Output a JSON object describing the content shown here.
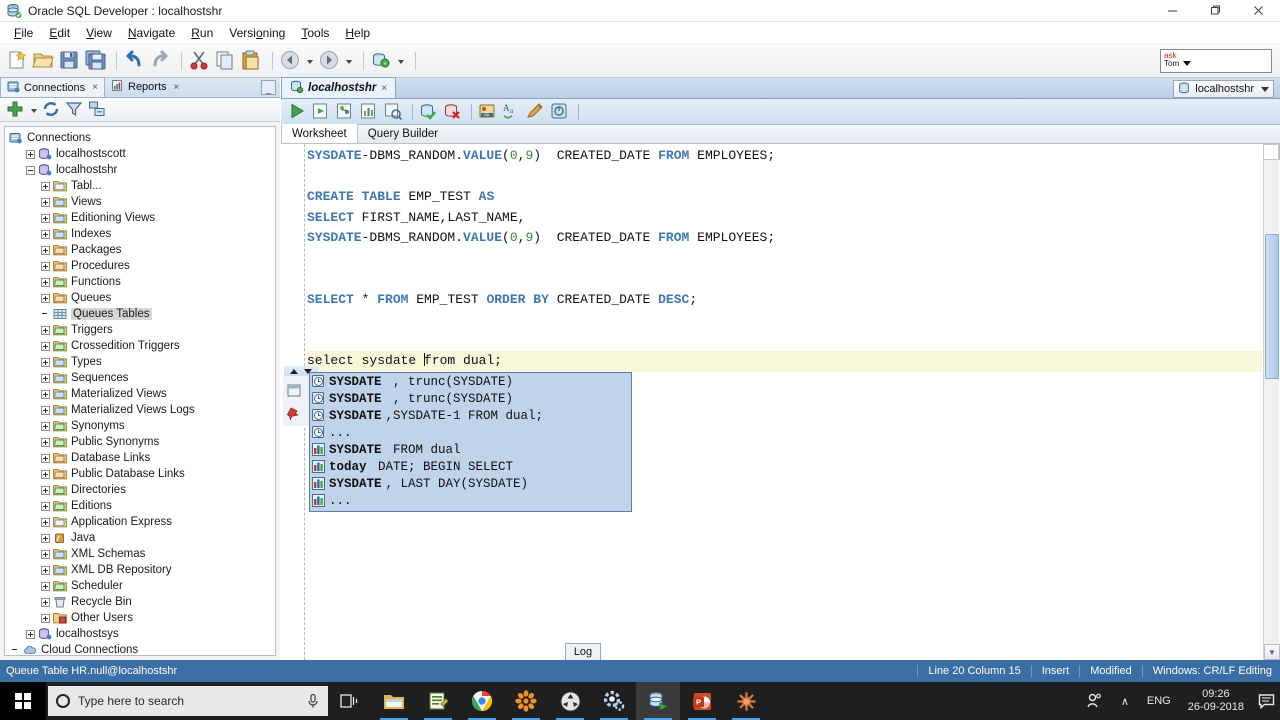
{
  "window": {
    "title": "Oracle SQL Developer : localhostshr",
    "app_icon": "database-app-icon",
    "minimize": "—",
    "maximize": "❐",
    "close": "✕"
  },
  "menubar": {
    "items": [
      {
        "label": "File",
        "mnemonic": "F"
      },
      {
        "label": "Edit",
        "mnemonic": "E"
      },
      {
        "label": "View",
        "mnemonic": "V"
      },
      {
        "label": "Navigate",
        "mnemonic": "N"
      },
      {
        "label": "Run",
        "mnemonic": "R"
      },
      {
        "label": "Versioning",
        "mnemonic": "o"
      },
      {
        "label": "Tools",
        "mnemonic": "T"
      },
      {
        "label": "Help",
        "mnemonic": "H"
      }
    ]
  },
  "main_toolbar": {
    "buttons": [
      "new-file-icon",
      "open-folder-icon",
      "save-icon",
      "save-all-icon",
      "undo-icon",
      "redo-icon",
      "cut-icon",
      "copy-icon",
      "paste-icon",
      "navigate-back-icon",
      "navigate-forward-icon",
      "new-connection-icon"
    ],
    "search_box": {
      "line1": "ask",
      "line2": "Tom"
    }
  },
  "left_dock": {
    "tabs": [
      {
        "label": "Connections",
        "icon": "connections-icon",
        "close": "×",
        "active": true
      },
      {
        "label": "Reports",
        "icon": "reports-icon",
        "close": "×",
        "active": false
      }
    ],
    "minimize_label": "_",
    "toolbar_buttons": [
      "new-connection-plus-icon",
      "dropdown-caret-icon",
      "refresh-icon",
      "filter-icon",
      "collapse-all-icon"
    ],
    "tree": {
      "root": {
        "label": "Connections",
        "icon": "connections-root-icon"
      },
      "nodes": [
        {
          "label": "localhostscott",
          "level": 1,
          "icon": "connection-icon",
          "expander": "plus"
        },
        {
          "label": "localhostshr",
          "level": 1,
          "icon": "connection-icon",
          "expander": "minus"
        },
        {
          "label": "Tabl...",
          "level": 2,
          "icon": "tables-folder-icon",
          "expander": "plus"
        },
        {
          "label": "Views",
          "level": 2,
          "icon": "views-folder-icon",
          "expander": "plus"
        },
        {
          "label": "Editioning Views",
          "level": 2,
          "icon": "editioning-views-icon",
          "expander": "plus"
        },
        {
          "label": "Indexes",
          "level": 2,
          "icon": "indexes-folder-icon",
          "expander": "plus"
        },
        {
          "label": "Packages",
          "level": 2,
          "icon": "packages-folder-icon",
          "expander": "plus"
        },
        {
          "label": "Procedures",
          "level": 2,
          "icon": "procedures-folder-icon",
          "expander": "plus"
        },
        {
          "label": "Functions",
          "level": 2,
          "icon": "functions-folder-icon",
          "expander": "plus"
        },
        {
          "label": "Queues",
          "level": 2,
          "icon": "queues-folder-icon",
          "expander": "plus"
        },
        {
          "label": "Queues Tables",
          "level": 2,
          "icon": "queue-tables-icon",
          "expander": "none",
          "selected": true
        },
        {
          "label": "Triggers",
          "level": 2,
          "icon": "triggers-folder-icon",
          "expander": "plus"
        },
        {
          "label": "Crossedition Triggers",
          "level": 2,
          "icon": "crossedition-triggers-icon",
          "expander": "plus"
        },
        {
          "label": "Types",
          "level": 2,
          "icon": "types-folder-icon",
          "expander": "plus"
        },
        {
          "label": "Sequences",
          "level": 2,
          "icon": "sequences-folder-icon",
          "expander": "plus"
        },
        {
          "label": "Materialized Views",
          "level": 2,
          "icon": "materialized-views-icon",
          "expander": "plus"
        },
        {
          "label": "Materialized Views Logs",
          "level": 2,
          "icon": "materialized-views-logs-icon",
          "expander": "plus"
        },
        {
          "label": "Synonyms",
          "level": 2,
          "icon": "synonyms-folder-icon",
          "expander": "plus"
        },
        {
          "label": "Public Synonyms",
          "level": 2,
          "icon": "public-synonyms-icon",
          "expander": "plus"
        },
        {
          "label": "Database Links",
          "level": 2,
          "icon": "database-links-icon",
          "expander": "plus"
        },
        {
          "label": "Public Database Links",
          "level": 2,
          "icon": "public-database-links-icon",
          "expander": "plus"
        },
        {
          "label": "Directories",
          "level": 2,
          "icon": "directories-folder-icon",
          "expander": "plus"
        },
        {
          "label": "Editions",
          "level": 2,
          "icon": "editions-folder-icon",
          "expander": "plus"
        },
        {
          "label": "Application Express",
          "level": 2,
          "icon": "application-express-icon",
          "expander": "plus"
        },
        {
          "label": "Java",
          "level": 2,
          "icon": "java-folder-icon",
          "expander": "plus"
        },
        {
          "label": "XML Schemas",
          "level": 2,
          "icon": "xml-schemas-icon",
          "expander": "plus"
        },
        {
          "label": "XML DB Repository",
          "level": 2,
          "icon": "xml-db-repository-icon",
          "expander": "plus"
        },
        {
          "label": "Scheduler",
          "level": 2,
          "icon": "scheduler-folder-icon",
          "expander": "plus"
        },
        {
          "label": "Recycle Bin",
          "level": 2,
          "icon": "recycle-bin-icon",
          "expander": "plus"
        },
        {
          "label": "Other Users",
          "level": 2,
          "icon": "other-users-icon",
          "expander": "plus"
        },
        {
          "label": "localhostsys",
          "level": 1,
          "icon": "connection-icon",
          "expander": "plus"
        },
        {
          "label": "Cloud Connections",
          "level": 0,
          "icon": "cloud-icon",
          "expander": "none"
        }
      ]
    }
  },
  "editor": {
    "worksheet_tab": {
      "label": "localhostshr",
      "icon": "worksheet-icon",
      "close": "×"
    },
    "connection_selector": {
      "label": "localhostshr",
      "icon": "database-icon"
    },
    "collapse_label": "▾",
    "toolbar_buttons": [
      "run-statement-icon",
      "run-script-icon",
      "explain-plan-icon",
      "autotrace-icon",
      "sql-history-icon",
      "commit-icon",
      "rollback-icon",
      "compile-icon",
      "format-sql-icon",
      "clear-icon",
      "query-builder-icon"
    ],
    "sub_tabs": [
      {
        "label": "Worksheet",
        "active": true
      },
      {
        "label": "Query Builder",
        "active": false
      }
    ],
    "code_lines": [
      {
        "id": 1,
        "current": false,
        "tokens": [
          {
            "t": "SYSDATE",
            "c": "kw"
          },
          {
            "t": "-DBMS_RANDOM.",
            "c": "plain"
          },
          {
            "t": "VALUE",
            "c": "kw"
          },
          {
            "t": "(",
            "c": "plain"
          },
          {
            "t": "0",
            "c": "num"
          },
          {
            "t": ",",
            "c": "plain"
          },
          {
            "t": "9",
            "c": "num"
          },
          {
            "t": ")  CREATED_DATE ",
            "c": "plain"
          },
          {
            "t": "FROM",
            "c": "kw"
          },
          {
            "t": " EMPLOYEES;",
            "c": "plain"
          }
        ]
      },
      {
        "id": 2,
        "current": false,
        "tokens": []
      },
      {
        "id": 3,
        "current": false,
        "tokens": [
          {
            "t": "CREATE",
            "c": "kw"
          },
          {
            "t": " ",
            "c": "plain"
          },
          {
            "t": "TABLE",
            "c": "kw"
          },
          {
            "t": " EMP_TEST ",
            "c": "plain"
          },
          {
            "t": "AS",
            "c": "kw"
          }
        ]
      },
      {
        "id": 4,
        "current": false,
        "tokens": [
          {
            "t": "SELECT",
            "c": "kw"
          },
          {
            "t": " FIRST_NAME,LAST_NAME,",
            "c": "plain"
          }
        ]
      },
      {
        "id": 5,
        "current": false,
        "tokens": [
          {
            "t": "SYSDATE",
            "c": "kw"
          },
          {
            "t": "-DBMS_RANDOM.",
            "c": "plain"
          },
          {
            "t": "VALUE",
            "c": "kw"
          },
          {
            "t": "(",
            "c": "plain"
          },
          {
            "t": "0",
            "c": "num"
          },
          {
            "t": ",",
            "c": "plain"
          },
          {
            "t": "9",
            "c": "num"
          },
          {
            "t": ")  CREATED_DATE ",
            "c": "plain"
          },
          {
            "t": "FROM",
            "c": "kw"
          },
          {
            "t": " EMPLOYEES;",
            "c": "plain"
          }
        ]
      },
      {
        "id": 6,
        "current": false,
        "tokens": []
      },
      {
        "id": 7,
        "current": false,
        "tokens": []
      },
      {
        "id": 8,
        "current": false,
        "tokens": [
          {
            "t": "SELECT",
            "c": "kw"
          },
          {
            "t": " * ",
            "c": "plain"
          },
          {
            "t": "FROM",
            "c": "kw"
          },
          {
            "t": " EMP_TEST ",
            "c": "plain"
          },
          {
            "t": "ORDER",
            "c": "kw"
          },
          {
            "t": " ",
            "c": "plain"
          },
          {
            "t": "BY",
            "c": "kw"
          },
          {
            "t": " CREATED_DATE ",
            "c": "plain"
          },
          {
            "t": "DESC",
            "c": "kw"
          },
          {
            "t": ";",
            "c": "plain"
          }
        ]
      },
      {
        "id": 9,
        "current": false,
        "tokens": []
      },
      {
        "id": 10,
        "current": false,
        "tokens": []
      },
      {
        "id": 11,
        "current": true,
        "tokens": [
          {
            "t": "select sysdate ",
            "c": "plain"
          },
          {
            "t": "|",
            "c": "caret"
          },
          {
            "t": "from dual;",
            "c": "plain"
          }
        ]
      }
    ],
    "log_tab_label": "Log"
  },
  "autocomplete": {
    "items": [
      {
        "icon": "snippet-clock-icon",
        "parts": [
          {
            "t": "SYSDATE",
            "bold": true
          },
          {
            "t": " , trunc(SYSDATE)",
            "bold": false
          }
        ]
      },
      {
        "icon": "snippet-clock-icon",
        "parts": [
          {
            "t": "SYSDATE",
            "bold": true
          },
          {
            "t": " , trunc(SYSDATE)",
            "bold": false
          }
        ]
      },
      {
        "icon": "snippet-clock-icon",
        "parts": [
          {
            "t": "SYSDATE",
            "bold": true
          },
          {
            "t": ",SYSDATE-1 FROM dual;",
            "bold": false
          }
        ]
      },
      {
        "icon": "snippet-clock-icon",
        "parts": [
          {
            "t": "...",
            "bold": false
          }
        ]
      },
      {
        "icon": "snippet-chart-icon",
        "parts": [
          {
            "t": "SYSDATE",
            "bold": true
          },
          {
            "t": " FROM dual",
            "bold": false
          }
        ]
      },
      {
        "icon": "snippet-chart-icon",
        "parts": [
          {
            "t": "today",
            "bold": true
          },
          {
            "t": " DATE; BEGIN SELECT",
            "bold": false
          }
        ]
      },
      {
        "icon": "snippet-chart-icon",
        "parts": [
          {
            "t": "SYSDATE",
            "bold": true
          },
          {
            "t": ", LAST DAY(SYSDATE)",
            "bold": false
          }
        ]
      },
      {
        "icon": "snippet-chart-icon",
        "parts": [
          {
            "t": "...",
            "bold": false
          }
        ]
      }
    ]
  },
  "statusbar": {
    "left": "Queue Table HR.null@localhostshr",
    "position": "Line 20 Column 15",
    "mode": "Insert",
    "modified": "Modified",
    "encoding": "Windows: CR/LF Editing"
  },
  "taskbar": {
    "search_placeholder": "Type here to search",
    "apps": [
      {
        "name": "task-view-icon"
      },
      {
        "name": "file-explorer-icon"
      },
      {
        "name": "notepad-editor-icon"
      },
      {
        "name": "google-chrome-icon"
      },
      {
        "name": "gimp-icon"
      },
      {
        "name": "media-player-icon"
      },
      {
        "name": "settings-gear-icon"
      },
      {
        "name": "oracle-sql-developer-icon",
        "active": true
      },
      {
        "name": "powerpoint-icon"
      },
      {
        "name": "inkscape-icon"
      }
    ],
    "tray": {
      "people_icon": "people-icon",
      "chevron": "∧",
      "language": "ENG",
      "time": "09:26",
      "date": "26-09-2018",
      "notification_icon": "notification-icon"
    }
  },
  "colors": {
    "accent": "#3a6ea5",
    "keyword": "#3f77b5",
    "number": "#2d8a34",
    "popup_bg": "#bfd3ea",
    "current_line": "#f7f7d9"
  }
}
